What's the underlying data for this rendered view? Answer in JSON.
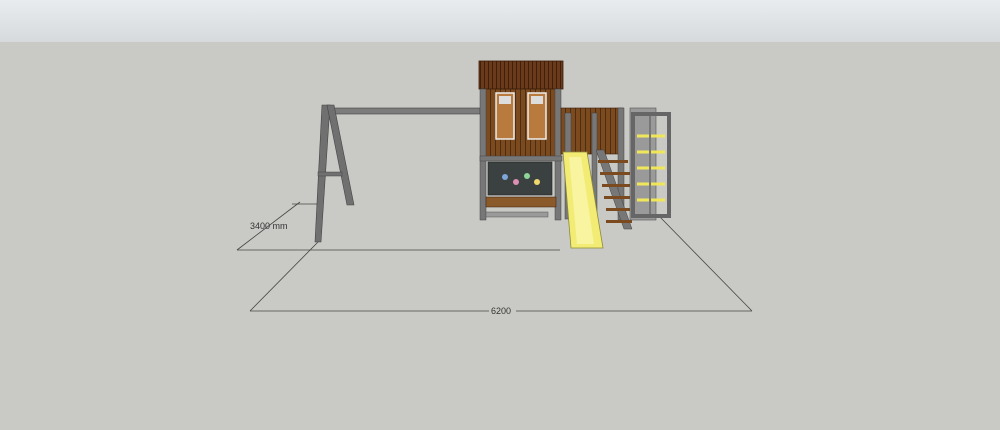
{
  "colors": {
    "sky": "#dfe2e4",
    "ground": "#c9c9c5",
    "frame": "#6e6e6e",
    "wood": "#7a4a1f",
    "roof": "#6a3818",
    "slide": "#f2ec74",
    "climbing_holds": "#f0e65a"
  },
  "dimensions": {
    "depth_label": "3400 mm",
    "width_label": "6200"
  },
  "model": {
    "name_icon": "playground-model",
    "parts": [
      "swing-frame",
      "playhouse",
      "slide",
      "stairs",
      "climbing-wall"
    ]
  }
}
